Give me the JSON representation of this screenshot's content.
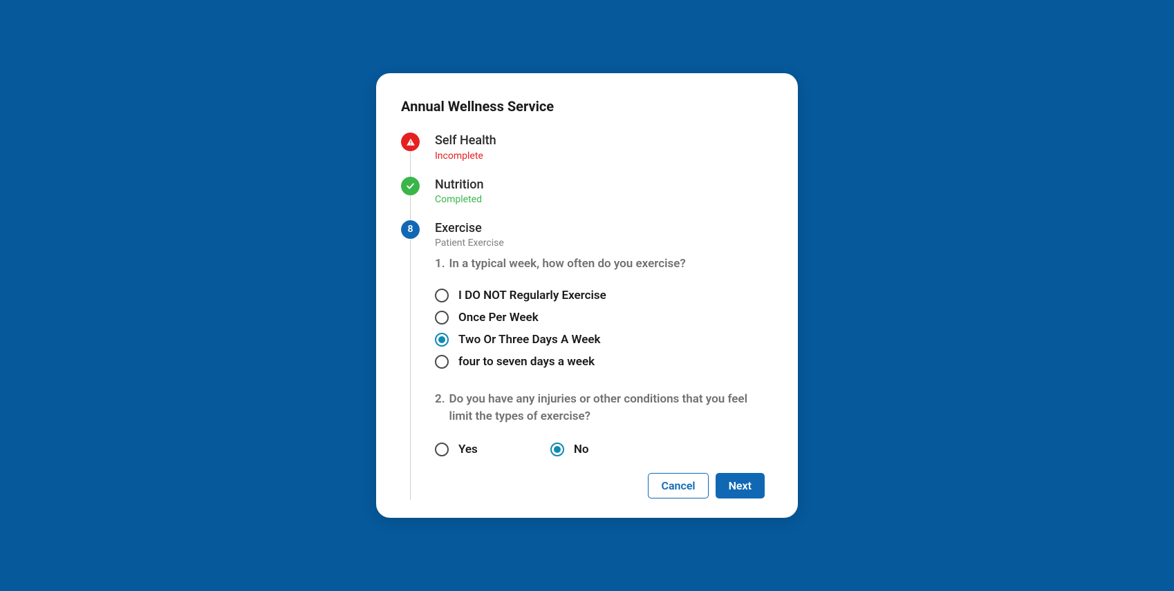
{
  "modal": {
    "title": "Annual Wellness Service",
    "steps": [
      {
        "title": "Self Health",
        "status": "Incomplete"
      },
      {
        "title": "Nutrition",
        "status": "Completed"
      },
      {
        "number": "8",
        "title": "Exercise",
        "subtitle": "Patient Exercise"
      }
    ],
    "questions": [
      {
        "number": "1.",
        "text": "In a typical week, how often do you exercise?",
        "options": [
          {
            "label": "I DO NOT Regularly Exercise",
            "selected": false
          },
          {
            "label": "Once Per Week",
            "selected": false
          },
          {
            "label": "Two Or Three Days A Week",
            "selected": true
          },
          {
            "label": "four to seven days a week",
            "selected": false
          }
        ]
      },
      {
        "number": "2.",
        "text": "Do you have any injuries or other conditions that you feel limit the types of exercise?",
        "options": [
          {
            "label": "Yes",
            "selected": false
          },
          {
            "label": "No",
            "selected": true
          }
        ]
      }
    ],
    "buttons": {
      "cancel": "Cancel",
      "next": "Next"
    }
  }
}
